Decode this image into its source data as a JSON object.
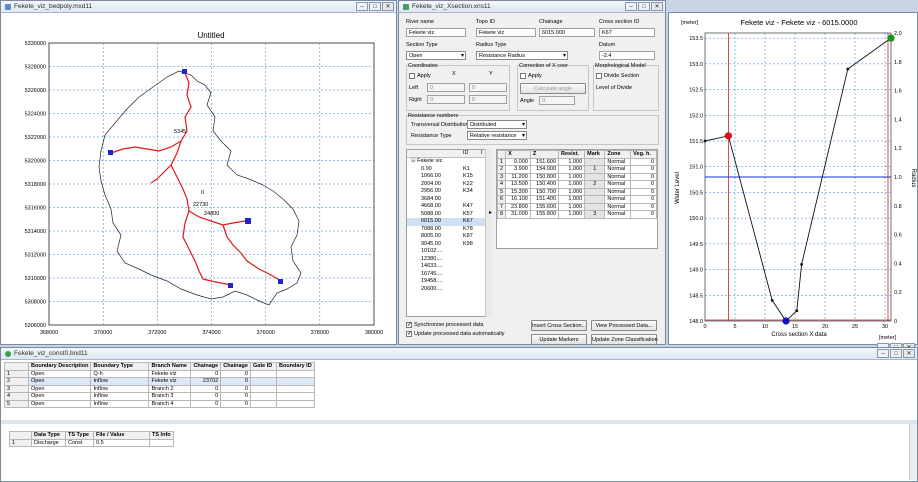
{
  "map_window": {
    "title": "Fekete_viz_bedpoly.mxd11",
    "map_title": "Untitled",
    "y_ticks": [
      "5330000",
      "5328000",
      "5326000",
      "5324000",
      "5322000",
      "5320000",
      "5318000",
      "5316000",
      "5314000",
      "5312000",
      "5310000",
      "5308000",
      "5306000"
    ],
    "x_ticks": [
      "368000",
      "370000",
      "372000",
      "374000",
      "376000",
      "378000",
      "380000"
    ],
    "annotations": [
      "5345",
      "0",
      "22730",
      "24800"
    ]
  },
  "xs_editor": {
    "title": "Fekete_viz_Xsection.xns11",
    "labels": {
      "river_name": "River name",
      "topo_id": "Topo ID",
      "chainage": "Chainage",
      "cross_section_id": "Cross section ID",
      "section_type": "Section Type",
      "radius_type": "Radius Type",
      "datum": "Datum",
      "coordinates": "Coordinates",
      "apply": "Apply",
      "x": "X",
      "y": "Y",
      "left": "Left",
      "right": "Right",
      "correction": "Correction of X coor",
      "apply2": "Apply",
      "calc_angle": "Calculate angle",
      "angle": "Angle",
      "morph_model": "Morphological Model",
      "divide_section": "Divide Section",
      "level_of_divide": "Level of Divide",
      "resistance_numbers": "Resistance numbers",
      "transversal_distribution": "Transversal Distribution",
      "resistance_type": "Resistance Type"
    },
    "values": {
      "river_name": "Fekete viz",
      "topo_id": "Fekete viz",
      "chainage": "6015.000",
      "cross_section_id": "K67",
      "section_type": "Open",
      "radius_type": "Resistance Radius",
      "datum": "-2.4",
      "left_x": "0",
      "left_y": "0",
      "right_x": "0",
      "right_y": "0",
      "angle": "0",
      "transversal_distribution": "Distributed",
      "resistance_type": "Relative resistance"
    },
    "tree_header": {
      "col1": "",
      "col2": "ID",
      "col3": "I"
    },
    "tree_root": "Fekete viz",
    "tree_items": [
      {
        "ch": "0.00",
        "id": "K1"
      },
      {
        "ch": "1066.00",
        "id": "K15"
      },
      {
        "ch": "2004.00",
        "id": "K22"
      },
      {
        "ch": "2956.00",
        "id": "K34"
      },
      {
        "ch": "3684.00",
        "id": ""
      },
      {
        "ch": "4668.00",
        "id": "K47"
      },
      {
        "ch": "5088.00",
        "id": "K57"
      },
      {
        "ch": "6015.00",
        "id": "K67"
      },
      {
        "ch": "7088.00",
        "id": "K78"
      },
      {
        "ch": "8005.00",
        "id": "K87"
      },
      {
        "ch": "9045.00",
        "id": "K98"
      },
      {
        "ch": "10102....",
        "id": ""
      },
      {
        "ch": "12380....",
        "id": ""
      },
      {
        "ch": "14633....",
        "id": ""
      },
      {
        "ch": "16745....",
        "id": ""
      },
      {
        "ch": "19458....",
        "id": ""
      },
      {
        "ch": "20600....",
        "id": ""
      }
    ],
    "grid_headers": [
      "",
      "X",
      "Z",
      "Resist.",
      "Mark",
      "Zone",
      "Veg. h."
    ],
    "grid_rows": [
      {
        "n": "1",
        "x": "0.000",
        "z": "151.600",
        "r": "1.000",
        "m": "",
        "zone": "Normal",
        "v": "0"
      },
      {
        "n": "2",
        "x": "3.900",
        "z": "154.000",
        "r": "1.000",
        "m": "1",
        "zone": "Normal",
        "v": "0"
      },
      {
        "n": "3",
        "x": "11.200",
        "z": "150.800",
        "r": "1.000",
        "m": "",
        "zone": "Normal",
        "v": "0"
      },
      {
        "n": "4",
        "x": "13.500",
        "z": "150.400",
        "r": "1.000",
        "m": "2",
        "zone": "Normal",
        "v": "0"
      },
      {
        "n": "5",
        "x": "15.300",
        "z": "150.700",
        "r": "1.000",
        "m": "",
        "zone": "Normal",
        "v": "0"
      },
      {
        "n": "6",
        "x": "16.100",
        "z": "151.400",
        "r": "1.000",
        "m": "",
        "zone": "Normal",
        "v": "0"
      },
      {
        "n": "7",
        "x": "23.800",
        "z": "155.600",
        "r": "1.000",
        "m": "",
        "zone": "Normal",
        "v": "0"
      },
      {
        "n": "8",
        "x": "31.000",
        "z": "155.800",
        "r": "1.000",
        "m": "3",
        "zone": "Normal",
        "v": "0"
      }
    ],
    "sync_label": "Synchronise processed data",
    "update_label": "Update processed data automatically",
    "buttons": {
      "insert": "Insert Cross Section...",
      "view": "View Processed Data...",
      "update_markers": "Update Markers",
      "update_zone": "Update Zone Classification"
    }
  },
  "chart_window": {
    "title": "",
    "unit_left": "[meter]",
    "unit_bottom": "[meter]"
  },
  "chart_data": {
    "type": "line",
    "title": "Fekete viz - Fekete viz - 6015.0000",
    "xlabel": "Cross section X data",
    "ylabel": "Water Level",
    "y2label": "Radius",
    "xlim": [
      0,
      31
    ],
    "ylim": [
      148.0,
      153.6
    ],
    "y2lim": [
      0,
      2
    ],
    "x_ticks": [
      "0",
      "5",
      "10",
      "15",
      "20",
      "25",
      "30"
    ],
    "y_ticks": [
      "148.0",
      "148.5",
      "149.0",
      "149.5",
      "150.0",
      "150.5",
      "151.0",
      "151.5",
      "152.0",
      "152.5",
      "153.0",
      "153.5"
    ],
    "y2_ticks": [
      "0",
      "0.2",
      "0.4",
      "0.6",
      "0.8",
      "1.0",
      "1.2",
      "1.4",
      "1.6",
      "1.8",
      "2.0"
    ],
    "series": [
      {
        "name": "Cross section",
        "x": [
          0,
          3.9,
          11.2,
          13.5,
          15.3,
          16.1,
          23.8,
          31.0
        ],
        "y": [
          151.5,
          151.6,
          148.4,
          148.0,
          148.2,
          149.1,
          152.9,
          153.5
        ]
      }
    ],
    "markers": [
      {
        "label": "1",
        "x": 3.9,
        "y": 151.6,
        "color": "#dd1111"
      },
      {
        "label": "2",
        "x": 13.5,
        "y": 148.0,
        "color": "#1111cc"
      },
      {
        "label": "3",
        "x": 31.0,
        "y": 153.5,
        "color": "#119911"
      }
    ],
    "water_level": 150.8,
    "water_color": "#1133cc",
    "vline_x": 3.9,
    "vline_color": "#cc2222"
  },
  "boundary_window": {
    "title": "Fekete_viz_const0.bnd11",
    "headers": [
      "",
      "Boundary Description",
      "Boundary Type",
      "Branch Name",
      "Chainage",
      "Chainage",
      "Gate ID",
      "Boundary ID"
    ],
    "rows": [
      {
        "n": "1",
        "desc": "Open",
        "type": "Q-h",
        "branch": "Fekete viz",
        "ch1": "0",
        "ch2": "0",
        "gate": "",
        "bid": ""
      },
      {
        "n": "2",
        "desc": "Open",
        "type": "Inflow",
        "branch": "Fekete viz",
        "ch1": "23702",
        "ch2": "0",
        "gate": "",
        "bid": ""
      },
      {
        "n": "3",
        "desc": "Open",
        "type": "Inflow",
        "branch": "Branch 2",
        "ch1": "0",
        "ch2": "0",
        "gate": "",
        "bid": ""
      },
      {
        "n": "4",
        "desc": "Open",
        "type": "Inflow",
        "branch": "Branch 3",
        "ch1": "0",
        "ch2": "0",
        "gate": "",
        "bid": ""
      },
      {
        "n": "5",
        "desc": "Open",
        "type": "Inflow",
        "branch": "Branch 4",
        "ch1": "0",
        "ch2": "0",
        "gate": "",
        "bid": ""
      }
    ],
    "sub_headers": [
      "",
      "Data Type",
      "TS Type",
      "File / Value",
      "TS Info"
    ],
    "sub_rows": [
      {
        "n": "1",
        "dtype": "Discharge",
        "tstype": "Const",
        "value": "0.5",
        "info": ""
      }
    ]
  }
}
